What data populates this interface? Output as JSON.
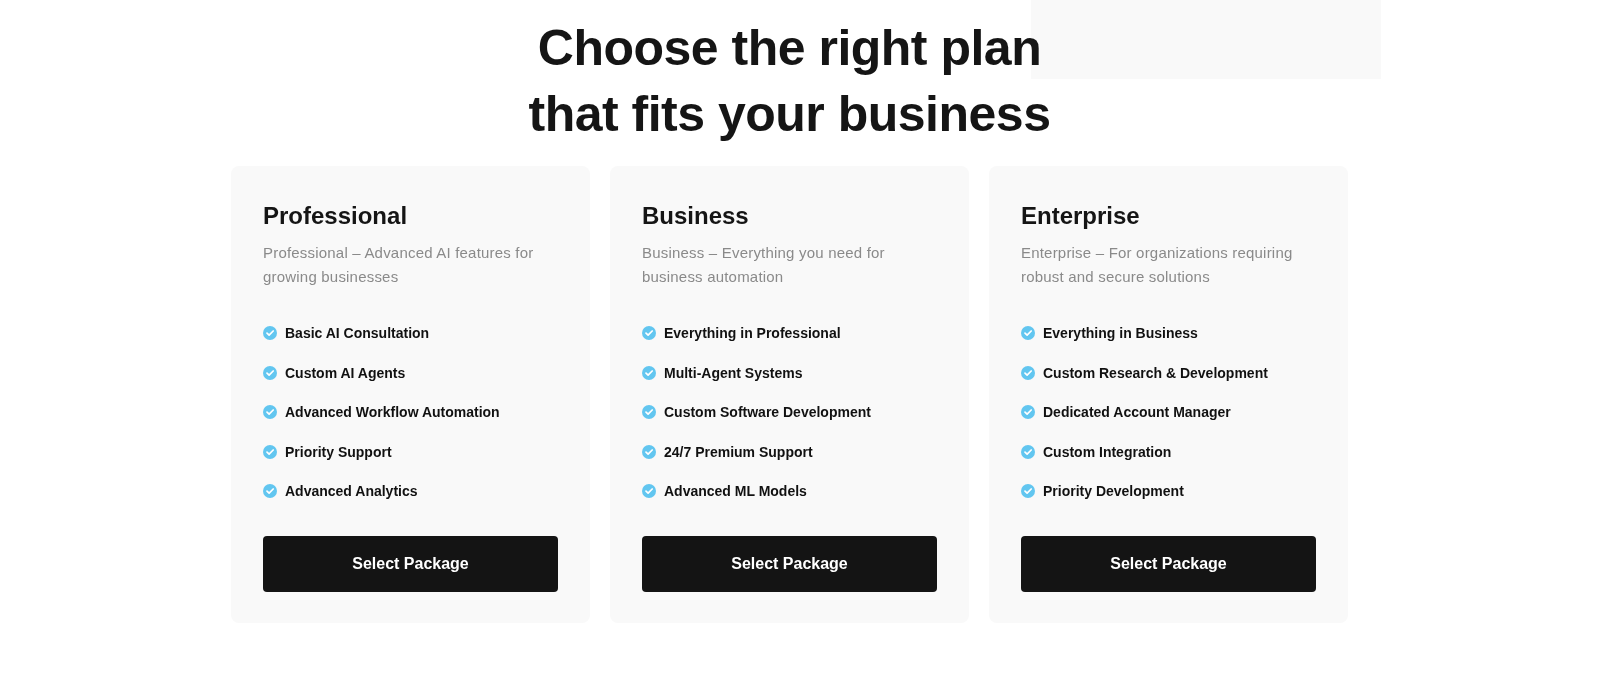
{
  "heading": "Choose the right plan that fits your business",
  "plans": [
    {
      "name": "Professional",
      "description": "Professional – Advanced AI features for growing businesses",
      "features": [
        "Basic AI Consultation",
        "Custom AI Agents",
        "Advanced Workflow Automation",
        "Priority Support",
        "Advanced Analytics"
      ],
      "button": "Select Package"
    },
    {
      "name": "Business",
      "description": "Business – Everything you need for business automation",
      "features": [
        "Everything in Professional",
        "Multi-Agent Systems",
        "Custom Software Development",
        "24/7 Premium Support",
        "Advanced ML Models"
      ],
      "button": "Select Package"
    },
    {
      "name": "Enterprise",
      "description": "Enterprise – For organizations requiring robust and secure solutions",
      "features": [
        "Everything in Business",
        "Custom Research & Development",
        "Dedicated Account Manager",
        "Custom Integration",
        "Priority Development"
      ],
      "button": "Select Package"
    }
  ]
}
